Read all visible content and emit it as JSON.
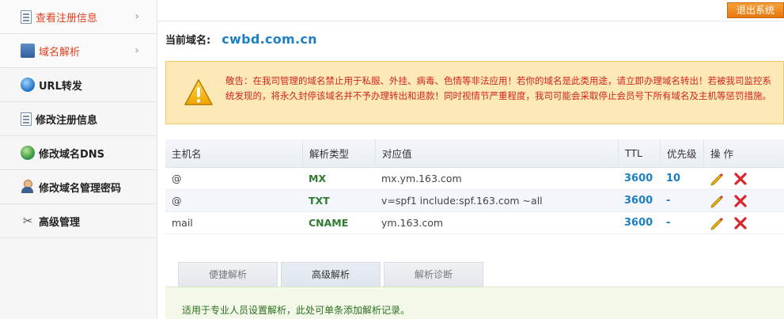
{
  "sidebar": {
    "items": [
      {
        "label": "查看注册信息",
        "icon": "document-icon",
        "highlighted": true,
        "chevron": "›"
      },
      {
        "label": "域名解析",
        "icon": "dns-icon",
        "highlighted": true,
        "chevron": "›"
      },
      {
        "label": "URL转发",
        "icon": "globe-icon"
      },
      {
        "label": "修改注册信息",
        "icon": "edit-document-icon"
      },
      {
        "label": "修改域名DNS",
        "icon": "globe-network-icon"
      },
      {
        "label": "修改域名管理密码",
        "icon": "user-key-icon"
      },
      {
        "label": "高级管理",
        "icon": "tools-icon"
      }
    ]
  },
  "header": {
    "logout_label": "退出系统"
  },
  "domain": {
    "label": "当前域名:",
    "value": "cwbd.com.cn"
  },
  "warning": {
    "text": "敬告：在我司管理的域名禁止用于私服、外挂、病毒、色情等非法应用！若你的域名是此类用途，请立即办理域名转出！若被我司监控系统发现的，将永久封停该域名并不予办理转出和退款！同时视情节严重程度，我司可能会采取停止会员号下所有域名及主机等惩罚措施。"
  },
  "table": {
    "headers": [
      "主机名",
      "解析类型",
      "对应值",
      "TTL",
      "优先级",
      "操 作"
    ],
    "rows": [
      {
        "host": "@",
        "type": "MX",
        "value": "mx.ym.163.com",
        "ttl": "3600",
        "priority": "10"
      },
      {
        "host": "@",
        "type": "TXT",
        "value": "v=spf1 include:spf.163.com ~all",
        "ttl": "3600",
        "priority": "-"
      },
      {
        "host": "mail",
        "type": "CNAME",
        "value": "ym.163.com",
        "ttl": "3600",
        "priority": "-"
      }
    ]
  },
  "tabs": [
    {
      "label": "便捷解析",
      "active": false
    },
    {
      "label": "高级解析",
      "active": true
    },
    {
      "label": "解析诊断",
      "active": false
    }
  ],
  "tab_note": "适用于专业人员设置解析，此处可单条添加解析记录。",
  "colors": {
    "accent_blue": "#1d7fc4",
    "warning_red": "#d3231e",
    "type_green": "#2f7b2f",
    "logout_orange": "#f08a1f"
  }
}
